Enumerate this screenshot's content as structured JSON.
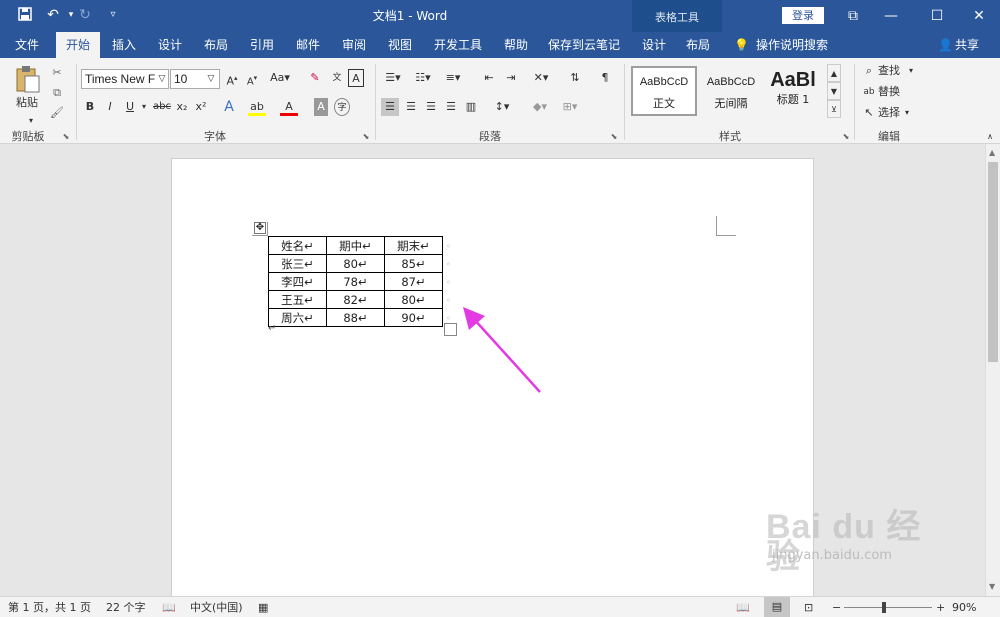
{
  "title_bar": {
    "doc_title": "文档1  -  Word",
    "context_title": "表格工具",
    "login_label": "登录"
  },
  "tabs": [
    "文件",
    "开始",
    "插入",
    "设计",
    "布局",
    "引用",
    "邮件",
    "审阅",
    "视图",
    "开发工具",
    "帮助",
    "保存到云笔记"
  ],
  "context_tabs": [
    "设计",
    "布局"
  ],
  "tell_me": "操作说明搜索",
  "share": "共享",
  "ribbon": {
    "clipboard": {
      "paste_label": "粘贴",
      "group_label": "剪贴板"
    },
    "font": {
      "font_name": "Times New F",
      "font_size": "10",
      "group_label": "字体",
      "bold": "B",
      "italic": "I",
      "underline": "U",
      "strike": "abc",
      "sub": "x₂",
      "sup": "x²"
    },
    "paragraph": {
      "group_label": "段落"
    },
    "styles": {
      "group_label": "样式",
      "items": [
        {
          "preview": "AaBbCcD",
          "name": "正文"
        },
        {
          "preview": "AaBbCcD",
          "name": "无间隔"
        },
        {
          "preview": "AaBl",
          "name": "标题 1"
        }
      ]
    },
    "editing": {
      "group_label": "编辑",
      "find": "查找",
      "replace": "替换",
      "select": "选择"
    }
  },
  "document": {
    "table": {
      "header": [
        "姓名↵",
        "期中↵",
        "期末↵"
      ],
      "rows": [
        [
          "张三↵",
          "80↵",
          "85↵"
        ],
        [
          "李四↵",
          "78↵",
          "87↵"
        ],
        [
          "王五↵",
          "82↵",
          "80↵"
        ],
        [
          "周六↵",
          "88↵",
          "90↵"
        ]
      ]
    },
    "paragraph_mark": "↵"
  },
  "status": {
    "page": "第 1 页，共 1 页",
    "words": "22 个字",
    "lang": "中文(中国)",
    "zoom": "90%",
    "zoom_level": 0.9
  },
  "watermark": {
    "brand": "Bai du 经验",
    "url": "jingyan.baidu.com"
  },
  "colors": {
    "brand_blue": "#2b579a",
    "arrow": "#e43ae3",
    "ribbon_bg": "#f3f3f3"
  }
}
